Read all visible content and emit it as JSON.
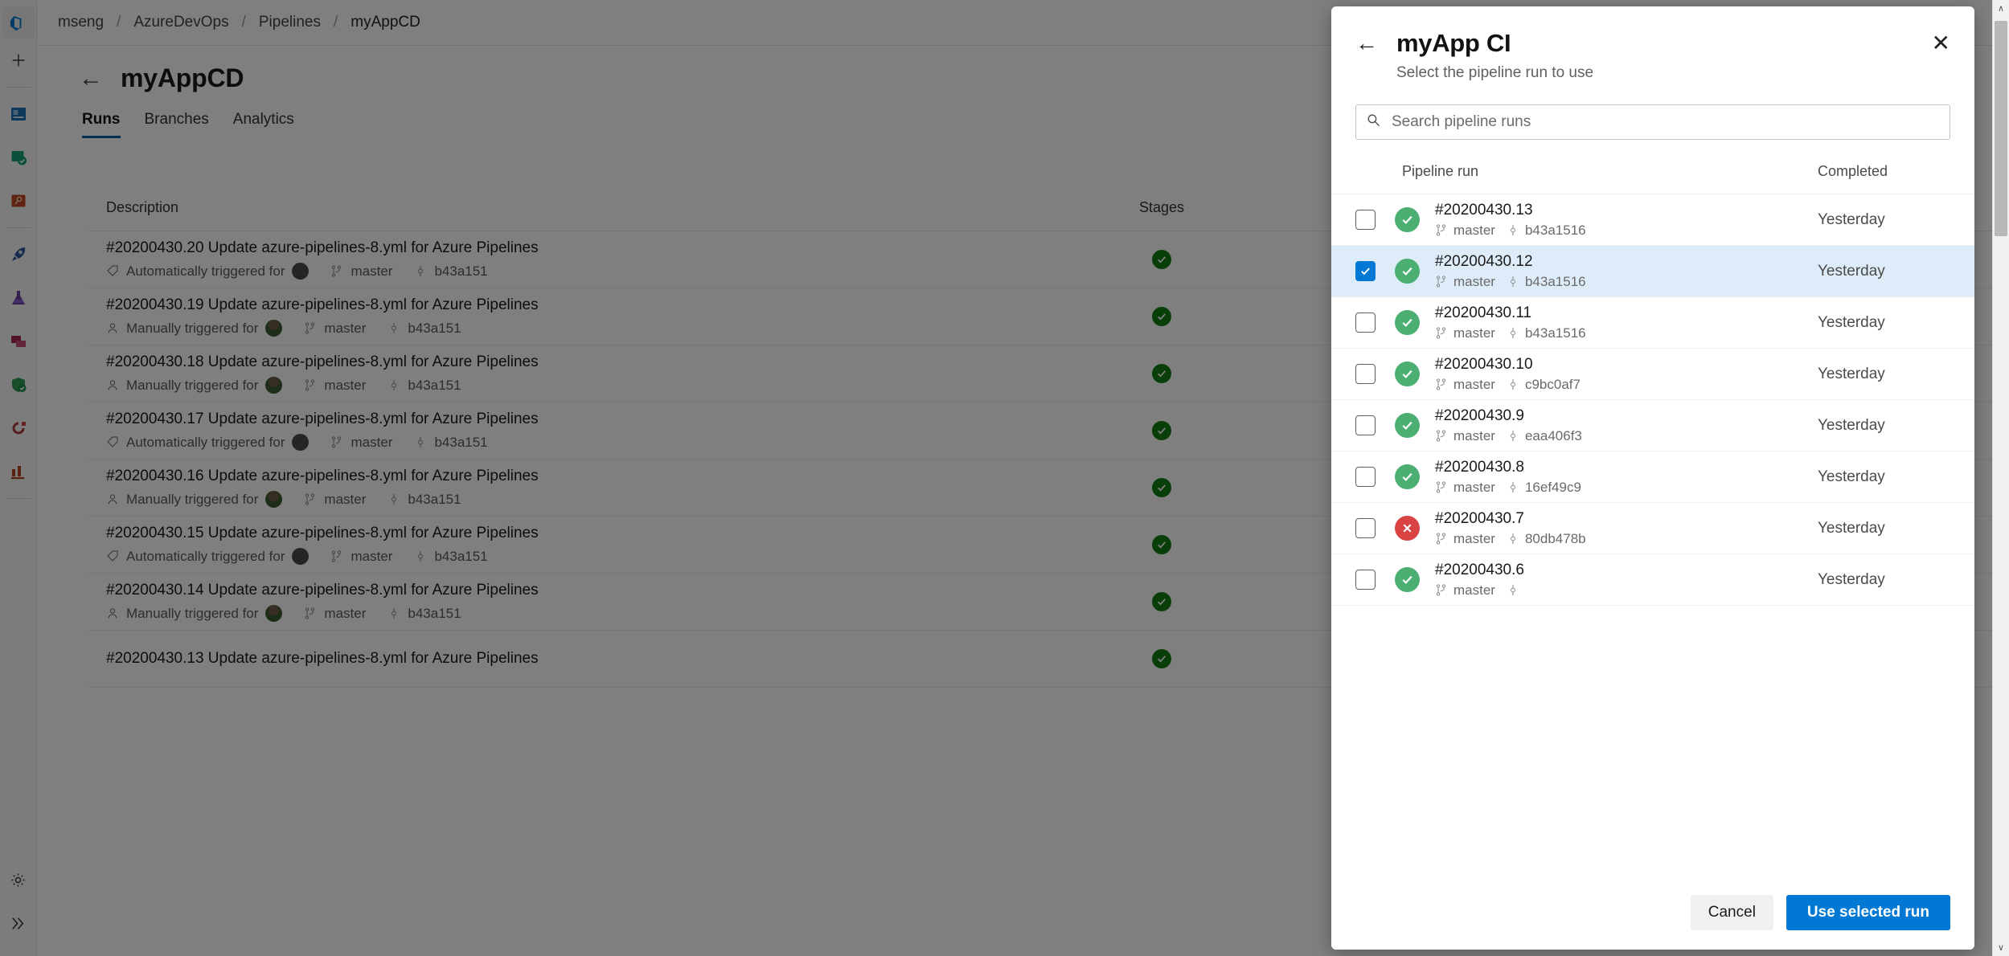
{
  "background": {
    "breadcrumb": [
      "mseng",
      "AzureDevOps",
      "Pipelines",
      "myAppCD"
    ],
    "breadcrumb_separator": "/",
    "page_title": "myAppCD",
    "back_arrow": "←",
    "tabs": [
      {
        "label": "Runs",
        "active": true
      },
      {
        "label": "Branches",
        "active": false
      },
      {
        "label": "Analytics",
        "active": false
      }
    ],
    "table": {
      "columns": [
        "Description",
        "Stages"
      ],
      "rows": [
        {
          "title": "#20200430.20 Update azure-pipelines-8.yml for Azure Pipelines",
          "trigger": "Automatically triggered for",
          "trigger_kind": "auto",
          "branch": "master",
          "commit": "b43a151",
          "stage": "succeeded"
        },
        {
          "title": "#20200430.19 Update azure-pipelines-8.yml for Azure Pipelines",
          "trigger": "Manually triggered for",
          "trigger_kind": "manual",
          "branch": "master",
          "commit": "b43a151",
          "stage": "succeeded"
        },
        {
          "title": "#20200430.18 Update azure-pipelines-8.yml for Azure Pipelines",
          "trigger": "Manually triggered for",
          "trigger_kind": "manual",
          "branch": "master",
          "commit": "b43a151",
          "stage": "succeeded"
        },
        {
          "title": "#20200430.17 Update azure-pipelines-8.yml for Azure Pipelines",
          "trigger": "Automatically triggered for",
          "trigger_kind": "auto",
          "branch": "master",
          "commit": "b43a151",
          "stage": "succeeded"
        },
        {
          "title": "#20200430.16 Update azure-pipelines-8.yml for Azure Pipelines",
          "trigger": "Manually triggered for",
          "trigger_kind": "manual",
          "branch": "master",
          "commit": "b43a151",
          "stage": "succeeded"
        },
        {
          "title": "#20200430.15 Update azure-pipelines-8.yml for Azure Pipelines",
          "trigger": "Automatically triggered for",
          "trigger_kind": "auto",
          "branch": "master",
          "commit": "b43a151",
          "stage": "succeeded"
        },
        {
          "title": "#20200430.14 Update azure-pipelines-8.yml for Azure Pipelines",
          "trigger": "Manually triggered for",
          "trigger_kind": "manual",
          "branch": "master",
          "commit": "b43a151",
          "stage": "succeeded"
        },
        {
          "title": "#20200430.13 Update azure-pipelines-8.yml for Azure Pipelines",
          "trigger": "",
          "trigger_kind": "none",
          "branch": "",
          "commit": "",
          "stage": "succeeded"
        }
      ]
    },
    "rail_icons": [
      "azure-devops-logo-icon",
      "plus-icon",
      "boards-icon",
      "test-plans-shield-icon",
      "repos-icon",
      "pipelines-rocket-icon",
      "artifacts-flask-icon",
      "packages-icon",
      "security-shield-icon",
      "release-icon",
      "analytics-bar-chart-icon",
      "settings-gear-icon",
      "expand-chevrons-icon"
    ]
  },
  "dialog": {
    "back_arrow": "←",
    "close_icon_label": "✕",
    "title": "myApp CI",
    "subtitle": "Select the pipeline run to use",
    "search": {
      "placeholder": "Search pipeline runs",
      "value": ""
    },
    "columns": {
      "run": "Pipeline run",
      "completed": "Completed"
    },
    "runs": [
      {
        "name": "#20200430.13",
        "branch": "master",
        "commit": "b43a1516",
        "completed": "Yesterday",
        "status": "succeeded",
        "checked": false
      },
      {
        "name": "#20200430.12",
        "branch": "master",
        "commit": "b43a1516",
        "completed": "Yesterday",
        "status": "succeeded",
        "checked": true
      },
      {
        "name": "#20200430.11",
        "branch": "master",
        "commit": "b43a1516",
        "completed": "Yesterday",
        "status": "succeeded",
        "checked": false
      },
      {
        "name": "#20200430.10",
        "branch": "master",
        "commit": "c9bc0af7",
        "completed": "Yesterday",
        "status": "succeeded",
        "checked": false
      },
      {
        "name": "#20200430.9",
        "branch": "master",
        "commit": "eaa406f3",
        "completed": "Yesterday",
        "status": "succeeded",
        "checked": false
      },
      {
        "name": "#20200430.8",
        "branch": "master",
        "commit": "16ef49c9",
        "completed": "Yesterday",
        "status": "succeeded",
        "checked": false
      },
      {
        "name": "#20200430.7",
        "branch": "master",
        "commit": "80db478b",
        "completed": "Yesterday",
        "status": "failed",
        "checked": false
      },
      {
        "name": "#20200430.6",
        "branch": "master",
        "commit": "",
        "completed": "Yesterday",
        "status": "succeeded",
        "checked": false
      }
    ],
    "footer": {
      "cancel_label": "Cancel",
      "confirm_label": "Use selected run"
    }
  },
  "colors": {
    "accent": "#0078d4",
    "selected_row": "#deecf9",
    "success_green": "#4caf72",
    "failure_red": "#d94343",
    "stage_green": "#107c10",
    "tab_underline": "#0b5c9e"
  },
  "scrollbar": {
    "up_arrow": "∧",
    "down_arrow": "∨"
  }
}
